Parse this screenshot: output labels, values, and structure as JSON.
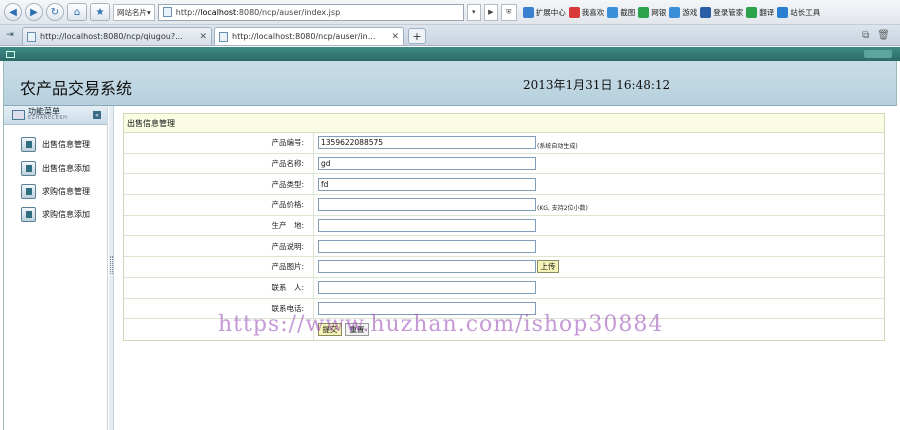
{
  "browser": {
    "favorites_label": "网站名片",
    "address_prefix": "http://",
    "address_host": "localhost",
    "address_rest": ":8080/ncp/auser/index.jsp",
    "tools": [
      {
        "label": "扩展中心",
        "color": "#3b7fd0",
        "icon": "extension-icon"
      },
      {
        "label": "我喜欢",
        "color": "#d83a3a",
        "icon": "heart-icon"
      },
      {
        "label": "截图",
        "color": "#3a8fd8",
        "icon": "scissors-icon"
      },
      {
        "label": "网银",
        "color": "#2aa34a",
        "icon": "bank-icon"
      },
      {
        "label": "游戏",
        "color": "#3a8fd8",
        "icon": "gamepad-icon"
      },
      {
        "label": "登录管家",
        "color": "#2a5fa8",
        "icon": "key-icon"
      },
      {
        "label": "翻译",
        "color": "#2aa34a",
        "icon": "translate-icon"
      },
      {
        "label": "站长工具",
        "color": "#2a7fd0",
        "icon": "webmaster-icon"
      }
    ],
    "tabs": [
      {
        "label": "http://localhost:8080/ncp/qiugou?...",
        "active": false
      },
      {
        "label": "http://localhost:8080/ncp/auser/in...",
        "active": true
      }
    ]
  },
  "app": {
    "title": "农产品交易系统",
    "datetime": "2013年1月31日  16:48:12",
    "menu": {
      "title": "功能菜单",
      "subtitle": "EZHANECEKH",
      "items": [
        "出售信息管理",
        "出售信息添加",
        "求购信息管理",
        "求购信息添加"
      ]
    },
    "form": {
      "panel_title": "出售信息管理",
      "fields": [
        {
          "label": "产品编号:",
          "value": "1359622088575",
          "hint": "(系统自动生成)"
        },
        {
          "label": "产品名称:",
          "value": "gd",
          "hint": ""
        },
        {
          "label": "产品类型:",
          "value": "fd",
          "hint": ""
        },
        {
          "label": "产品价格:",
          "value": "",
          "hint": "(KG, 支持2位小数)"
        },
        {
          "label": "生产　地:",
          "value": "",
          "hint": ""
        },
        {
          "label": "产品说明:",
          "value": "",
          "hint": ""
        },
        {
          "label": "产品图片:",
          "value": "",
          "hint": ""
        },
        {
          "label": "联系　人:",
          "value": "",
          "hint": ""
        },
        {
          "label": "联系电话:",
          "value": "",
          "hint": ""
        }
      ],
      "upload_label": "上传",
      "submit_label": "提交",
      "reset_label": "重置"
    },
    "watermark": "https://www.huzhan.com/ishop30884"
  }
}
